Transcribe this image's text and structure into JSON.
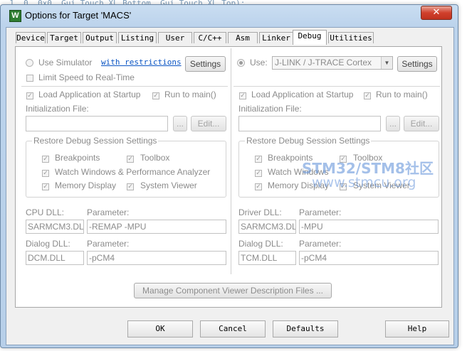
{
  "background_code": "  1, 0, 0x0, Gui_Touch_XL_Bottom, Gui_Touch_XL_Top);",
  "window": {
    "title": "Options for Target 'MACS'",
    "app_icon": "W",
    "close_glyph": "✕"
  },
  "tabs": [
    "Device",
    "Target",
    "Output",
    "Listing",
    "User",
    "C/C++",
    "Asm",
    "Linker",
    "Debug",
    "Utilities"
  ],
  "active_tab": "Debug",
  "left": {
    "use_simulator": "Use Simulator",
    "with_restrictions": "with restrictions",
    "settings": "Settings",
    "limit_speed": "Limit Speed to Real-Time",
    "load_app": "Load Application at Startup",
    "run_to_main": "Run to main()",
    "init_file_label": "Initialization File:",
    "init_file_value": "",
    "browse": "...",
    "edit": "Edit...",
    "restore_group": "Restore Debug Session Settings",
    "breakpoints": "Breakpoints",
    "toolbox": "Toolbox",
    "watch_windows": "Watch Windows & Performance Analyzer",
    "memory_display": "Memory Display",
    "system_viewer": "System Viewer",
    "dll_label": "CPU DLL:",
    "dll_param_label": "Parameter:",
    "dll_value": "SARMCM3.DLL",
    "dll_param_value": "-REMAP -MPU",
    "dialog_label": "Dialog DLL:",
    "dialog_param_label": "Parameter:",
    "dialog_value": "DCM.DLL",
    "dialog_param_value": "-pCM4"
  },
  "right": {
    "use": "Use:",
    "debugger_value": "J-LINK / J-TRACE Cortex",
    "settings": "Settings",
    "load_app": "Load Application at Startup",
    "run_to_main": "Run to main()",
    "init_file_label": "Initialization File:",
    "init_file_value": "",
    "browse": "...",
    "edit": "Edit...",
    "restore_group": "Restore Debug Session Settings",
    "breakpoints": "Breakpoints",
    "toolbox": "Toolbox",
    "watch_windows": "Watch Windows",
    "memory_display": "Memory Display",
    "system_viewer": "System Viewer",
    "dll_label": "Driver DLL:",
    "dll_param_label": "Parameter:",
    "dll_value": "SARMCM3.DLL",
    "dll_param_value": "-MPU",
    "dialog_label": "Dialog DLL:",
    "dialog_param_label": "Parameter:",
    "dialog_value": "TCM.DLL",
    "dialog_param_value": "-pCM4"
  },
  "manage_button": "Manage Component Viewer Description Files ...",
  "footer": {
    "ok": "OK",
    "cancel": "Cancel",
    "defaults": "Defaults",
    "help": "Help"
  },
  "watermark": {
    "line1": "STM32/STM8社区",
    "line2": "www.stmcu.org"
  },
  "check_glyph": "✓",
  "arrow_glyph": "▼"
}
